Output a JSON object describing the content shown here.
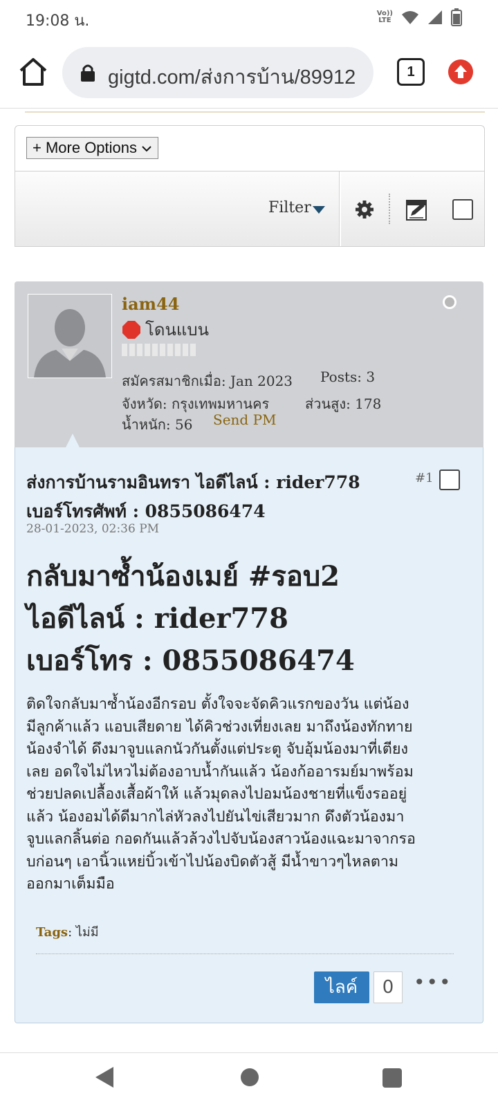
{
  "status_bar": {
    "time": "19:08 น.",
    "volte_top": "Vo))",
    "volte_bottom": "LTE"
  },
  "browser": {
    "url": "gigtd.com/ส่งการบ้าน/89912",
    "tab_count": "1"
  },
  "toolbar": {
    "more_options_label": "+ More Options",
    "filter_label": "Filter"
  },
  "post": {
    "author": {
      "username": "iam44",
      "status": "โดนแบน",
      "joined": "สมัครสมาชิกเมื่อ: Jan 2023",
      "posts": "Posts: 3",
      "province": "จังหวัด: กรุงเทพมหานคร",
      "height": "ส่วนสูง: 178",
      "weight": "น้ำหนัก: 56",
      "send_pm": "Send PM"
    },
    "title_line1": "ส่งการบ้านรามอินทรา ไอดีไลน์ : rider778",
    "title_line2": "เบอร์โทรศัพท์ : 0855086474",
    "number": "#1",
    "date": "28-01-2023, 02:36 PM",
    "headline_line1": "กลับมาซ้ำน้องเมย์ #รอบ2",
    "headline_line2": "ไอดีไลน์ : rider778",
    "headline_line3": "เบอร์โทร : 0855086474",
    "body_line1": "ติดใจกลับมาซ้ำน้องอีกรอบ ตั้งใจจะจัดคิวแรกของวัน แต่น้อง",
    "body_line2": "มีลูกค้าแล้ว แอบเสียดาย ได้คิวช่วงเที่ยงเลย มาถึงน้องทักทาย",
    "body_line3": "น้องจำได้ ดึงมาจูบแลกนัวกันตั้งแต่ประตู จับอุ้มน้องมาที่เตียง",
    "body_line4": "เลย อดใจไม่ไหวไม่ต้องอาบน้ำกันแล้ว น้องก้ออารมย์มาพร้อม",
    "body_line5": "ช่วยปลดเปลื้องเสื้อผ้าให้ แล้วมุดลงไปอมน้องชายที่แข็งรออยู่",
    "body_line6": "แล้ว น้องอมได้ดีมากไล่หัวลงไปยันไข่เสียวมาก ดึงตัวน้องมา",
    "body_line7": "จูบแลกลิ้นต่อ กอดกันแล้วล้วงไปจับน้องสาวน้องแฉะมาจากรอ",
    "body_line8": "บก่อนๆ เอานิ้วแหย่บิ้วเข้าไปน้องบิดตัวสู้ มีน้ำขาวๆไหลตาม",
    "body_line9": "ออกมาเต็มมือ",
    "tags_label": "Tags",
    "tags_value": ": ไม่มี",
    "like_label": "ไลค์",
    "like_count": "0",
    "more_label": "•••"
  }
}
